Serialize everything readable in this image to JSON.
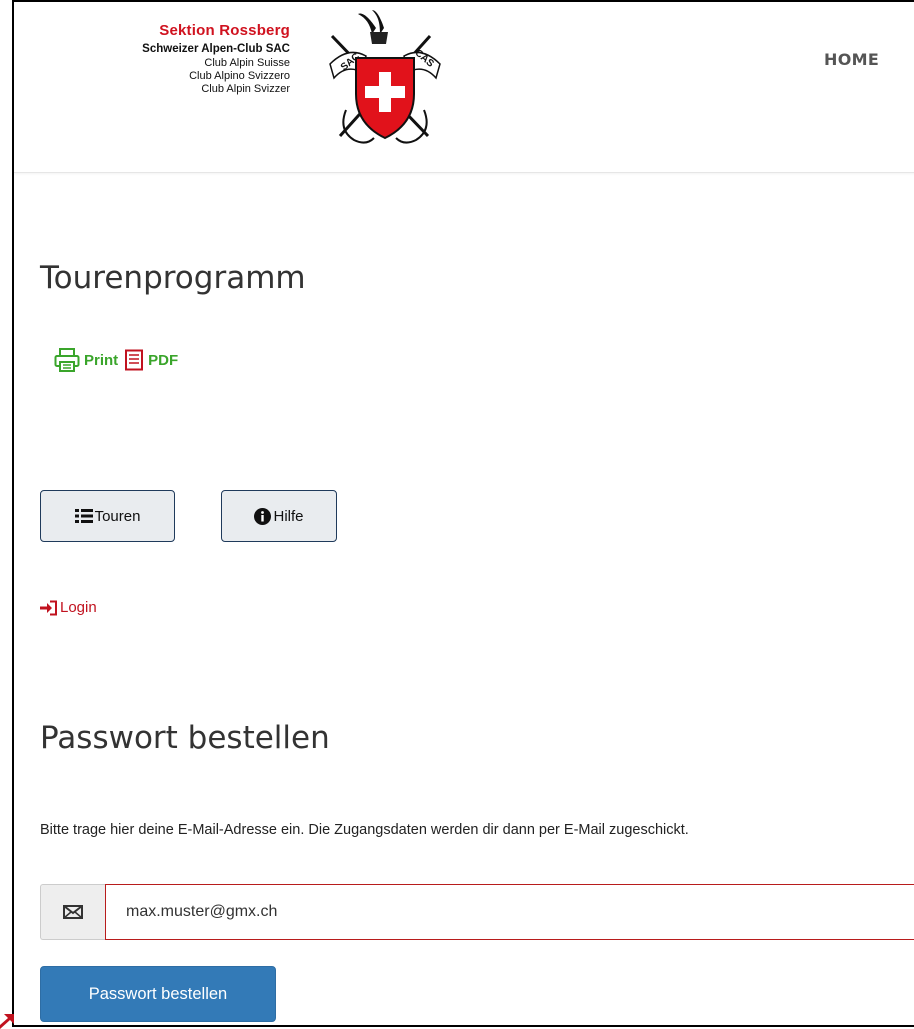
{
  "header": {
    "sektion": "Sektion Rossberg",
    "club_lines": [
      "Schweizer Alpen-Club SAC",
      "Club Alpin Suisse",
      "Club Alpino Svizzero",
      "Club Alpin Svizzer"
    ],
    "emblem_text_left": "SAC",
    "emblem_text_right": "CAS",
    "nav_home": "HOME"
  },
  "main": {
    "title": "Tourenprogramm",
    "tools": {
      "print_label": "Print",
      "pdf_label": "PDF"
    },
    "buttons": {
      "touren_label": "Touren",
      "hilfe_label": "Hilfe"
    },
    "login_label": "Login"
  },
  "password": {
    "title": "Passwort bestellen",
    "instruction": "Bitte trage hier deine E-Mail-Adresse ein. Die Zugangsdaten werden dir dann per E-Mail zugeschickt.",
    "email_value": "max.muster@gmx.ch",
    "submit_label": "Passwort bestellen"
  },
  "icons": {
    "print": "printer-icon",
    "pdf": "document-icon",
    "touren": "list-icon",
    "hilfe": "info-circle-icon",
    "login": "sign-in-icon",
    "email": "envelope-icon"
  },
  "colors": {
    "brand_red": "#d0121f",
    "tool_green": "#3aa52b",
    "link_red": "#c1121f",
    "primary_blue": "#337ab7"
  }
}
